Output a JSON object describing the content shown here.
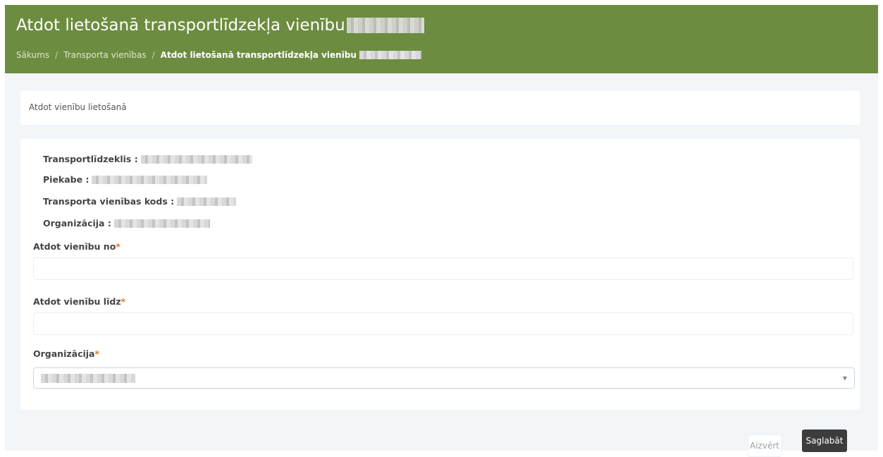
{
  "header": {
    "title": "Atdot lietošanā transportlīdzekļa vienību",
    "breadcrumb": {
      "items": [
        {
          "label": "Sākums"
        },
        {
          "label": "Transporta vienības"
        }
      ],
      "current": "Atdot lietošanā transportlīdzekļa vienību",
      "separator": "/"
    }
  },
  "card": {
    "title": "Atdot vienību lietošanā"
  },
  "info": {
    "vehicle_label": "Transportlīdzeklis :",
    "trailer_label": "Piekabe :",
    "unit_code_label": "Transporta vienības kods :",
    "organization_label": "Organizācija :"
  },
  "form": {
    "from_label": "Atdot vienību no",
    "from_value": "",
    "to_label": "Atdot vienību līdz",
    "to_value": "",
    "organization_label": "Organizācija",
    "required_mark": "*"
  },
  "actions": {
    "close_label": "Aizvērt",
    "save_label": "Saglabāt"
  },
  "colors": {
    "header_bg": "#6c8c3f",
    "page_bg": "#f3f6f9",
    "required": "#e0761f",
    "save_bg": "#3c3c3c"
  },
  "icons": {
    "select_arrow": "chevron-down-icon"
  }
}
